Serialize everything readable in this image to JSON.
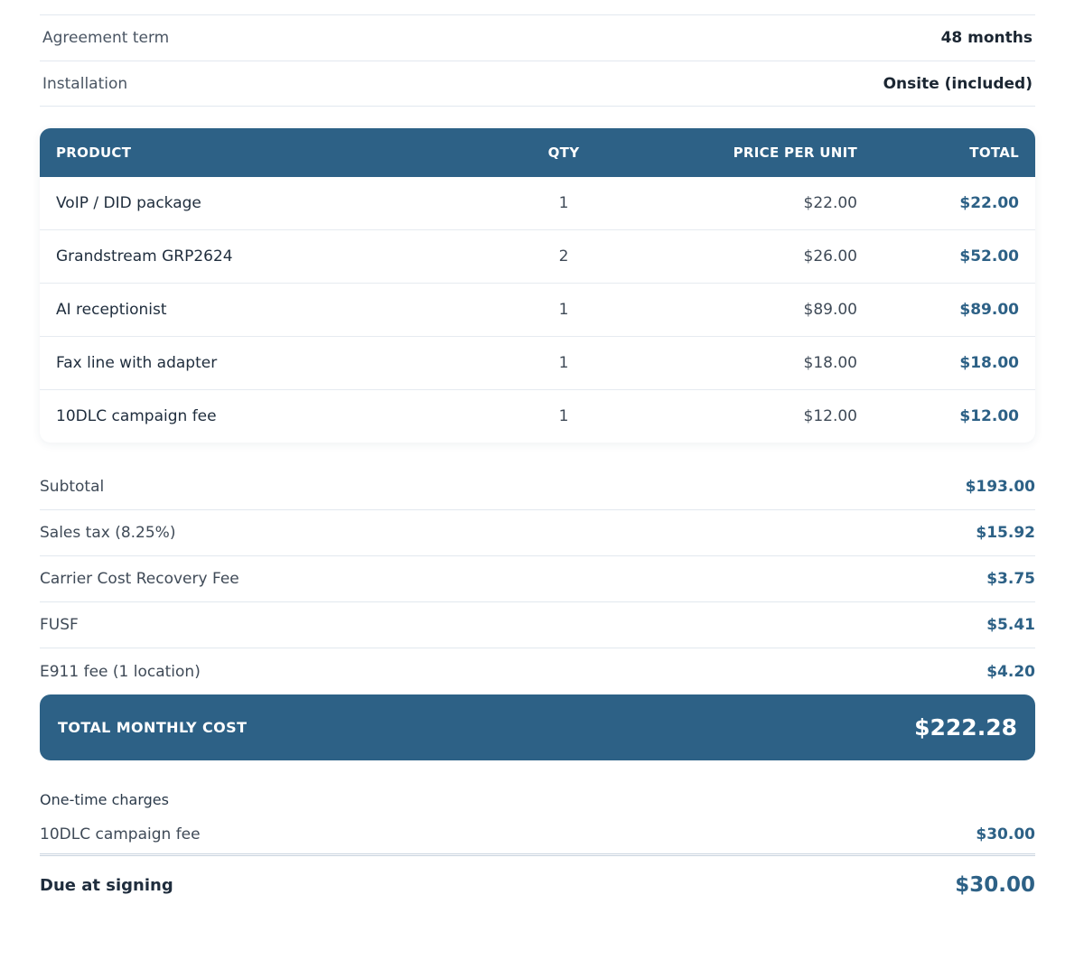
{
  "agreement": [
    {
      "label": "Agreement term",
      "value": "48 months"
    },
    {
      "label": "Installation",
      "value": "Onsite (included)"
    }
  ],
  "table": {
    "headers": {
      "product": "PRODUCT",
      "qty": "QTY",
      "price": "PRICE PER UNIT",
      "total": "TOTAL"
    },
    "rows": [
      {
        "product": "VoIP / DID package",
        "qty": "1",
        "price": "$22.00",
        "total": "$22.00"
      },
      {
        "product": "Grandstream GRP2624",
        "qty": "2",
        "price": "$26.00",
        "total": "$52.00"
      },
      {
        "product": "AI receptionist",
        "qty": "1",
        "price": "$89.00",
        "total": "$89.00"
      },
      {
        "product": "Fax line with adapter",
        "qty": "1",
        "price": "$18.00",
        "total": "$18.00"
      },
      {
        "product": "10DLC campaign fee",
        "qty": "1",
        "price": "$12.00",
        "total": "$12.00"
      }
    ]
  },
  "summary": [
    {
      "label": "Subtotal",
      "value": "$193.00"
    },
    {
      "label": "Sales tax (8.25%)",
      "value": "$15.92"
    },
    {
      "label": "Carrier Cost Recovery Fee",
      "value": "$3.75"
    },
    {
      "label": "FUSF",
      "value": "$5.41"
    },
    {
      "label": "E911 fee (1 location)",
      "value": "$4.20"
    }
  ],
  "total_monthly": {
    "label": "TOTAL MONTHLY COST",
    "value": "$222.28"
  },
  "one_time": {
    "title": "One-time charges",
    "items": [
      {
        "label": "10DLC campaign fee",
        "value": "$30.00"
      }
    ]
  },
  "due": {
    "label": "Due at signing",
    "value": "$30.00"
  },
  "colors": {
    "accent": "#2d6186",
    "divider": "#e2e8ef"
  }
}
